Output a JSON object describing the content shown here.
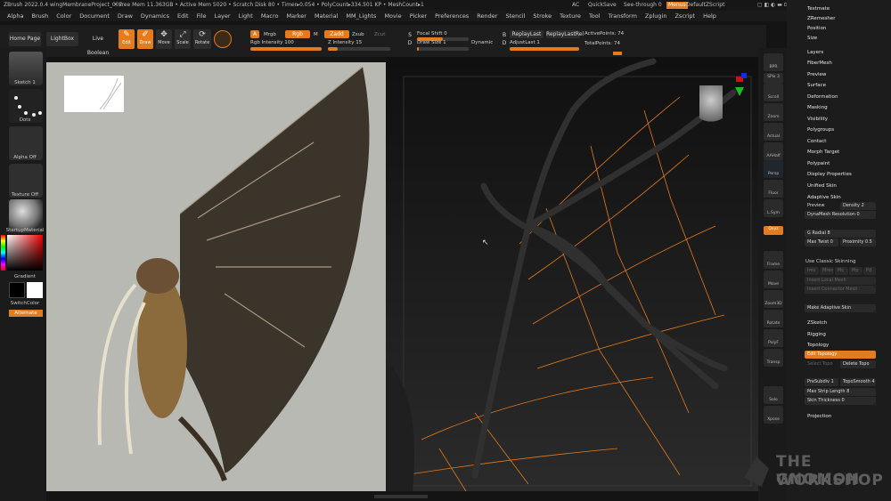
{
  "title_bar": {
    "app": "ZBrush 2022.0.4 wingMembraneProject_002",
    "status": "• Free Mem 11.363GB • Active Mem 5020 • Scratch Disk 80 • Timer▸0.054 • PolyCount▸334.501 KP • MeshCount▸1",
    "ac": "AC",
    "quicksave": "QuickSave",
    "see_through": "See-through",
    "see_through_value": "0",
    "menus": "Menus",
    "script": "DefaultZScript"
  },
  "menu": [
    "Alpha",
    "Brush",
    "Color",
    "Document",
    "Draw",
    "Dynamics",
    "Edit",
    "File",
    "Layer",
    "Light",
    "Macro",
    "Marker",
    "Material",
    "MM_Lights",
    "Movie",
    "Picker",
    "Preferences",
    "Render",
    "Stencil",
    "Stroke",
    "Texture",
    "Tool",
    "Transform",
    "Zplugin",
    "Zscript",
    "Help"
  ],
  "toolbar": {
    "home_page": "Home Page",
    "lightbox": "LightBox",
    "live_boolean": "Live Boolean",
    "edit": "Edit",
    "draw": "Draw",
    "move": "Move",
    "scale": "Scale",
    "rotate": "Rotate",
    "a_label": "A",
    "mrgb": "Mrgb",
    "rgb": "Rgb",
    "m": "M",
    "zadd": "Zadd",
    "zsub": "Zsub",
    "zcut": "Zcut",
    "rgb_intensity": "Rgb Intensity 100",
    "z_intensity": "Z Intensity 15",
    "focal_shift": "Focal Shift 0",
    "draw_size": "Draw Size 1",
    "dynamic": "Dynamic",
    "replay_last": "ReplayLast",
    "replay_last_rel": "ReplayLastRel",
    "adjust_last": "AdjustLast 1",
    "active_points": "ActivePoints: 74",
    "total_points": "TotalPoints: 74"
  },
  "left_shelf": {
    "brush": "Sketch 1",
    "stroke": "Dots",
    "alpha": "Alpha Off",
    "texture": "Texture Off",
    "material": "StartupMaterial",
    "gradient": "Gradient",
    "switch_color": "SwitchColor",
    "alternate": "Alternate"
  },
  "right_shelf": [
    "BPR",
    "SPix 3",
    "Scroll",
    "Zoom",
    "Actual",
    "AAHalf",
    "Persp",
    "Floor",
    "L.Sym",
    "Qxyz",
    "Frame",
    "Move",
    "Zoom3D",
    "Rotate",
    "PolyF",
    "Transp",
    "Solo",
    "Xpose"
  ],
  "tray": {
    "top_items": [
      "Testmate",
      "ZRemesher",
      "Position",
      "Size"
    ],
    "subpalettes": [
      "Layers",
      "FiberMesh",
      "Preview",
      "Surface",
      "Deformation",
      "Masking",
      "Visibility",
      "Polygroups",
      "Contact",
      "Morph Target",
      "Polypaint",
      "Display Properties",
      "Unified Skin",
      "Adaptive Skin"
    ],
    "adaptive": {
      "preview": "Preview",
      "density": "Density 2",
      "dynamesh_resolution": "DynaMesh Resolution 0",
      "g_radial": "G Radial 8",
      "max_twist": "Max Twist 0",
      "proximity": "Proximity 0.5",
      "use_classic_skinning": "Use Classic Skinning",
      "classic_buttons": [
        "Ires",
        "Mres",
        "Mc",
        "Mp",
        "Pd"
      ],
      "insert_local_mesh": "Insert Local Mesh",
      "insert_connector_mesh": "Insert Connector Mesh",
      "make_adaptive_skin": "Make Adaptive Skin"
    },
    "lower": [
      "ZSketch",
      "Rigging",
      "Topology"
    ],
    "topology": {
      "edit_topology": "Edit Topology",
      "select_topo": "Select Topo",
      "delete_topo": "Delete Topo",
      "presubdiv": "PreSubdiv 1",
      "topo_smooth": "TopoSmooth 4",
      "max_strip_length": "Max Strip Length 8",
      "skin_thickness": "Skin Thickness 0"
    },
    "projection": "Projection"
  },
  "watermark": {
    "line1": "THE GNOMON",
    "line2": "WORKSHOP"
  },
  "colors": {
    "accent": "#e47b1c",
    "bg": "#141414",
    "panel": "#1c1c1c"
  }
}
